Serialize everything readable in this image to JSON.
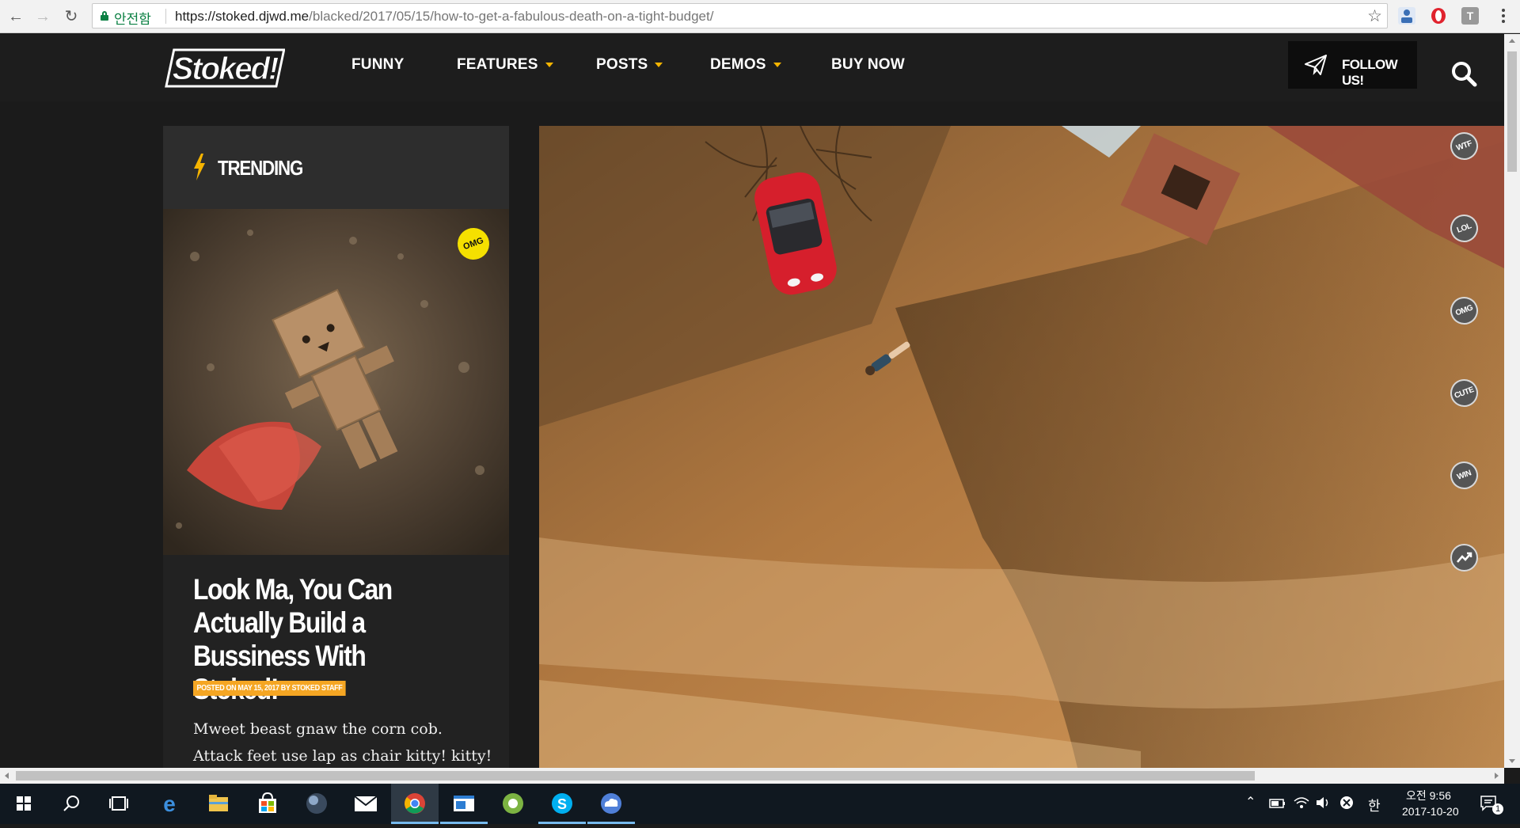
{
  "browser": {
    "security_label": "안전함",
    "url_host": "https://stoked.djwd.me",
    "url_path": "/blacked/2017/05/15/how-to-get-a-fabulous-death-on-a-tight-budget/"
  },
  "site": {
    "logo_text": "Stoked!",
    "nav": [
      {
        "label": "FUNNY",
        "dropdown": false
      },
      {
        "label": "FEATURES",
        "dropdown": true
      },
      {
        "label": "POSTS",
        "dropdown": true
      },
      {
        "label": "DEMOS",
        "dropdown": true
      },
      {
        "label": "BUY NOW",
        "dropdown": false
      }
    ],
    "follow_label": "FOLLOW US!",
    "accent_color": "#f5b400"
  },
  "trending": {
    "heading": "TRENDING",
    "badge": "OMG",
    "post_title": "Look Ma, You Can Actually Build a Bussiness With Stoked!",
    "post_meta": "POSTED ON MAY 15, 2017 BY STOKED STAFF",
    "excerpt_line1": "Mweet beast gnaw the corn cob.",
    "excerpt_line2": "Attack feet use lap as chair kitty! kitty!"
  },
  "reactions": [
    "WTF",
    "LOL",
    "OMG",
    "CUTE",
    "WIN",
    "trending-icon"
  ],
  "taskbar": {
    "ime": "한",
    "time": "오전 9:56",
    "date": "2017-10-20",
    "notification_count": "1"
  }
}
